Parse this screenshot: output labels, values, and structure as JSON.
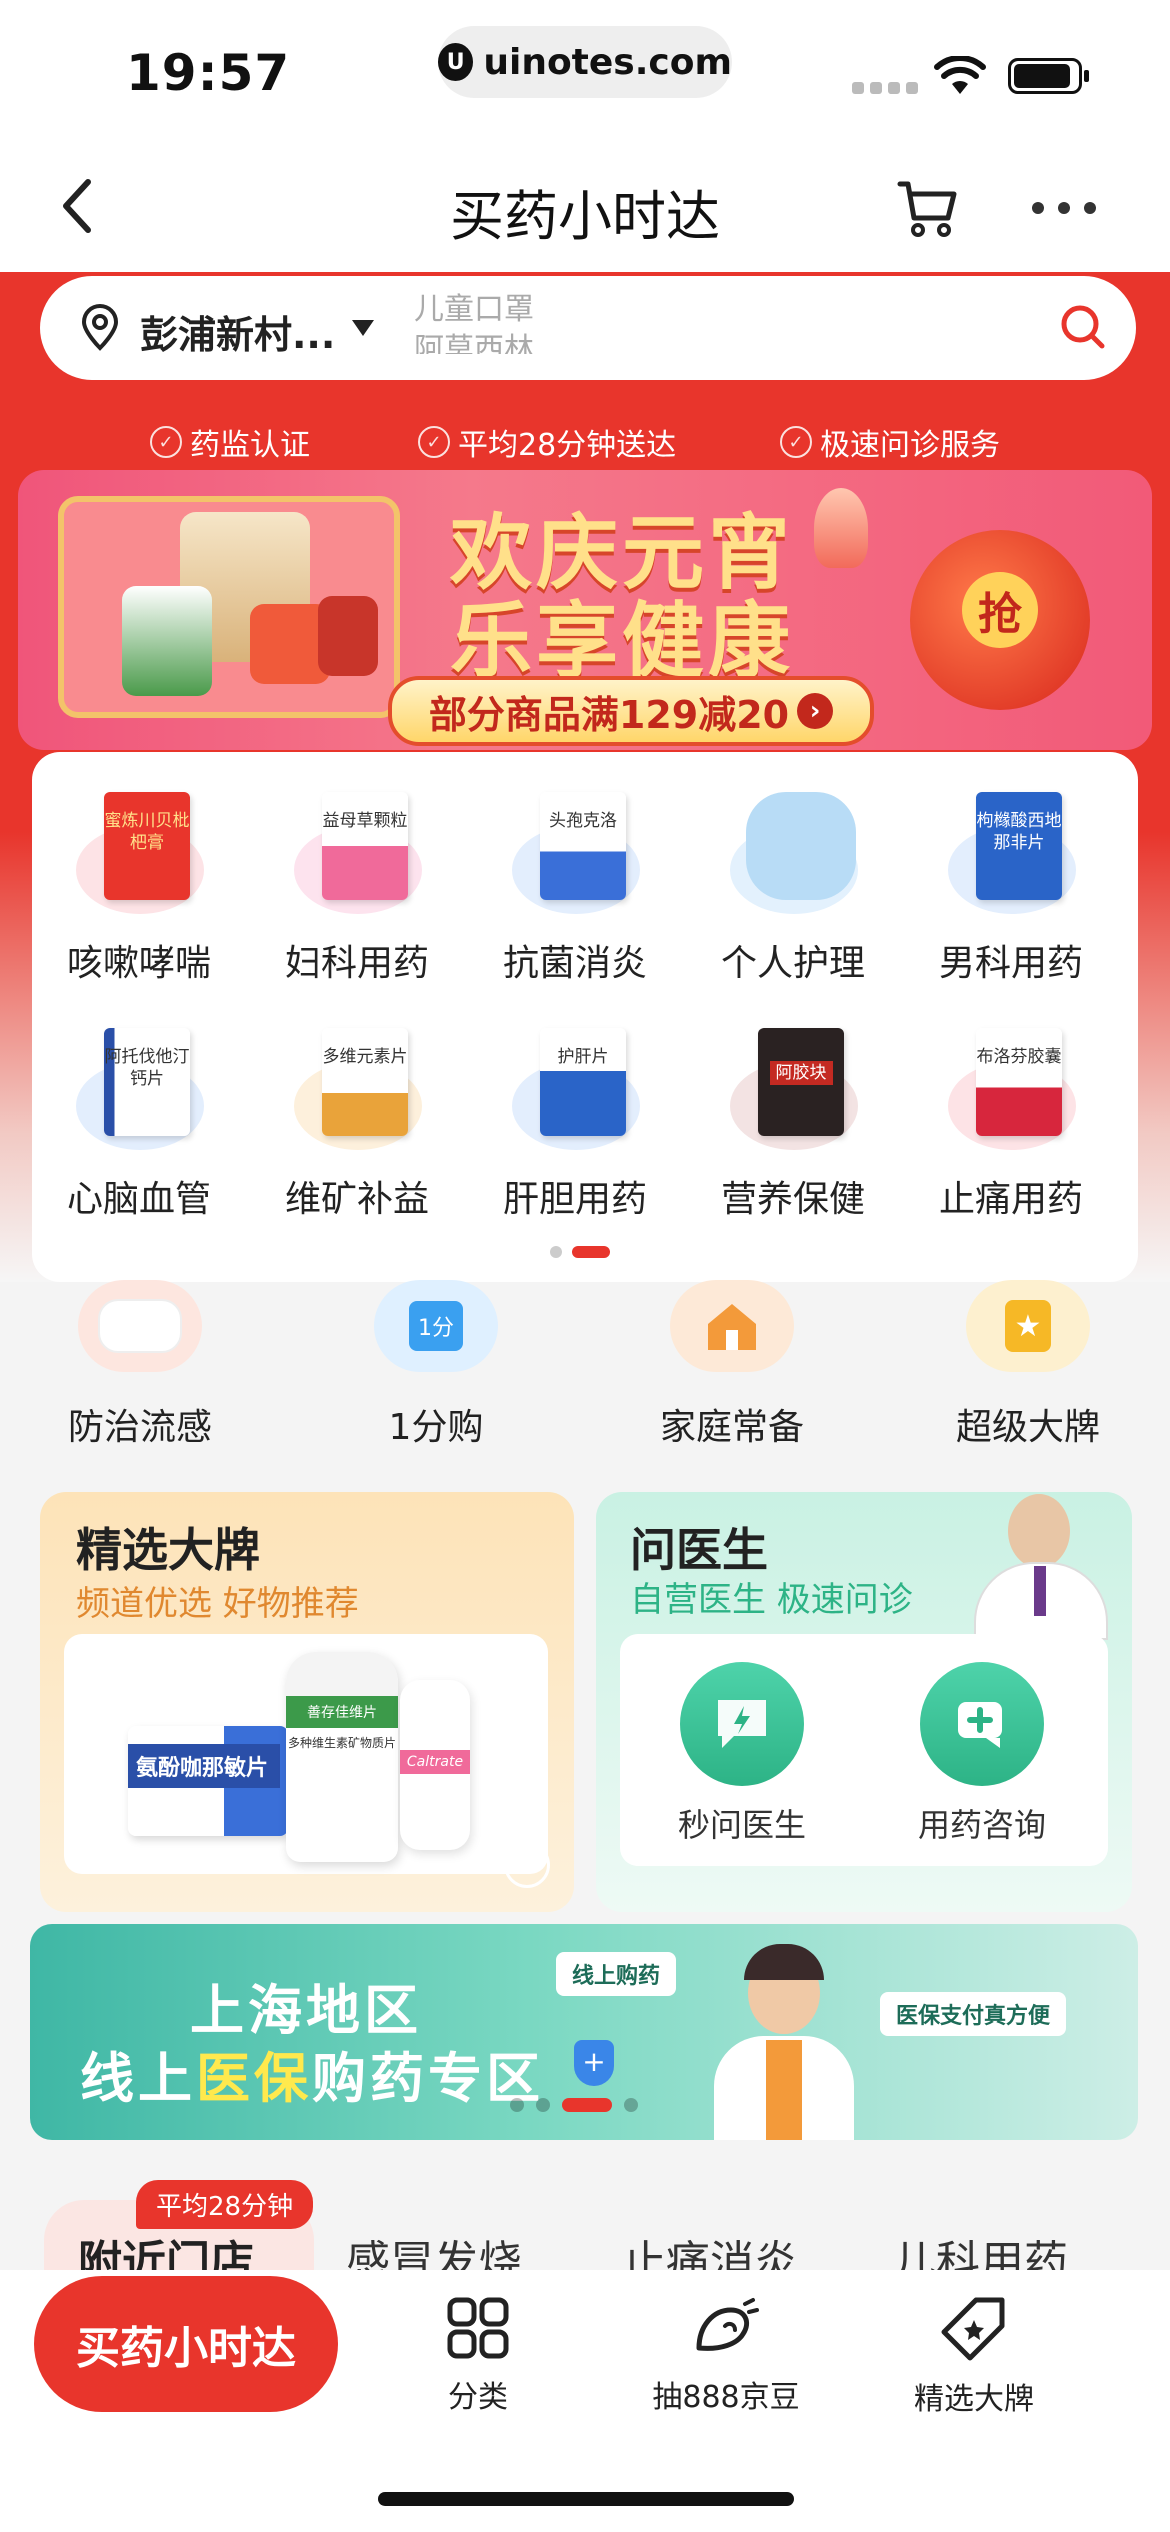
{
  "status_bar": {
    "time": "19:57",
    "url": "uinotes.com"
  },
  "nav": {
    "title": "买药小时达"
  },
  "search": {
    "location": "彭浦新村...",
    "placeholder_line1": "儿童口罩",
    "placeholder_line2": "阿莫西林"
  },
  "trust_badges": [
    "药监认证",
    "平均28分钟送达",
    "极速问诊服务"
  ],
  "banner": {
    "line1": "欢庆元宵",
    "line2": "乐享健康",
    "promo": "部分商品满129减20",
    "lantern_text": "抢"
  },
  "categories": [
    {
      "label": "咳嗽哮喘",
      "box_text": "蜜炼川贝枇杷膏",
      "color": "#e8352c"
    },
    {
      "label": "妇科用药",
      "box_text": "益母草颗粒",
      "color": "#f06a9a"
    },
    {
      "label": "抗菌消炎",
      "box_text": "头孢克洛",
      "color": "#3a6fd8"
    },
    {
      "label": "个人护理",
      "box_text": "",
      "color": "#8cc4f0"
    },
    {
      "label": "男科用药",
      "box_text": "枸橼酸西地那非片",
      "color": "#2a64c8"
    },
    {
      "label": "心脑血管",
      "box_text": "阿托伐他汀钙片",
      "color": "#3a6fd8"
    },
    {
      "label": "维矿补益",
      "box_text": "多维元素片",
      "color": "#e9a33a"
    },
    {
      "label": "肝胆用药",
      "box_text": "护肝片",
      "color": "#2a64c8"
    },
    {
      "label": "营养保健",
      "box_text": "阿胶块",
      "color": "#c42a22"
    },
    {
      "label": "止痛用药",
      "box_text": "布洛芬胶囊",
      "color": "#d7263d"
    }
  ],
  "quick_links": [
    {
      "label": "防治流感",
      "icon": "mask-icon",
      "bg": "#fde6df"
    },
    {
      "label": "1分购",
      "icon": "basket-icon",
      "badge": "1分",
      "bg": "#dff0ff"
    },
    {
      "label": "家庭常备",
      "icon": "home-icon",
      "bg": "#fde9d7"
    },
    {
      "label": "超级大牌",
      "icon": "star-bag-icon",
      "bg": "#fdf0cf"
    }
  ],
  "brand_card": {
    "title": "精选大牌",
    "subtitle": "频道优选 好物推荐",
    "product1": "氨酚咖那敏片",
    "product2": "善存佳维片",
    "product2_sub": "多种维生素矿物质片",
    "product3": "Caltrate"
  },
  "doctor_card": {
    "title": "问医生",
    "subtitle": "自营医生 极速问诊",
    "btn1": "秒问医生",
    "btn2": "用药咨询"
  },
  "green_banner": {
    "line1": "上海地区",
    "line2_a": "线上",
    "line2_hl": "医保",
    "line2_b": "购药专区",
    "tag1": "线上购药",
    "tag2": "医保支付真方便"
  },
  "tabs": {
    "badge": "平均28分钟",
    "items": [
      "附近门店",
      "感冒发烧",
      "止痛消炎",
      "儿科用药"
    ]
  },
  "bottom_bar": {
    "cta": "买药小时达",
    "items": [
      {
        "label": "分类",
        "icon": "grid-icon"
      },
      {
        "label": "抽888京豆",
        "icon": "bean-icon"
      },
      {
        "label": "精选大牌",
        "icon": "tag-star-icon"
      }
    ]
  },
  "colors": {
    "brand_red": "#e8352c",
    "teal": "#2db386"
  }
}
